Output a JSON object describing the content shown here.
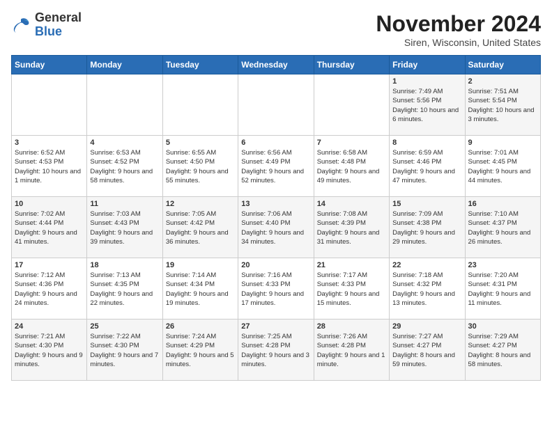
{
  "header": {
    "logo_general": "General",
    "logo_blue": "Blue",
    "month_title": "November 2024",
    "location": "Siren, Wisconsin, United States"
  },
  "weekdays": [
    "Sunday",
    "Monday",
    "Tuesday",
    "Wednesday",
    "Thursday",
    "Friday",
    "Saturday"
  ],
  "weeks": [
    [
      {
        "day": "",
        "info": ""
      },
      {
        "day": "",
        "info": ""
      },
      {
        "day": "",
        "info": ""
      },
      {
        "day": "",
        "info": ""
      },
      {
        "day": "",
        "info": ""
      },
      {
        "day": "1",
        "info": "Sunrise: 7:49 AM\nSunset: 5:56 PM\nDaylight: 10 hours and 6 minutes."
      },
      {
        "day": "2",
        "info": "Sunrise: 7:51 AM\nSunset: 5:54 PM\nDaylight: 10 hours and 3 minutes."
      }
    ],
    [
      {
        "day": "3",
        "info": "Sunrise: 6:52 AM\nSunset: 4:53 PM\nDaylight: 10 hours and 1 minute."
      },
      {
        "day": "4",
        "info": "Sunrise: 6:53 AM\nSunset: 4:52 PM\nDaylight: 9 hours and 58 minutes."
      },
      {
        "day": "5",
        "info": "Sunrise: 6:55 AM\nSunset: 4:50 PM\nDaylight: 9 hours and 55 minutes."
      },
      {
        "day": "6",
        "info": "Sunrise: 6:56 AM\nSunset: 4:49 PM\nDaylight: 9 hours and 52 minutes."
      },
      {
        "day": "7",
        "info": "Sunrise: 6:58 AM\nSunset: 4:48 PM\nDaylight: 9 hours and 49 minutes."
      },
      {
        "day": "8",
        "info": "Sunrise: 6:59 AM\nSunset: 4:46 PM\nDaylight: 9 hours and 47 minutes."
      },
      {
        "day": "9",
        "info": "Sunrise: 7:01 AM\nSunset: 4:45 PM\nDaylight: 9 hours and 44 minutes."
      }
    ],
    [
      {
        "day": "10",
        "info": "Sunrise: 7:02 AM\nSunset: 4:44 PM\nDaylight: 9 hours and 41 minutes."
      },
      {
        "day": "11",
        "info": "Sunrise: 7:03 AM\nSunset: 4:43 PM\nDaylight: 9 hours and 39 minutes."
      },
      {
        "day": "12",
        "info": "Sunrise: 7:05 AM\nSunset: 4:42 PM\nDaylight: 9 hours and 36 minutes."
      },
      {
        "day": "13",
        "info": "Sunrise: 7:06 AM\nSunset: 4:40 PM\nDaylight: 9 hours and 34 minutes."
      },
      {
        "day": "14",
        "info": "Sunrise: 7:08 AM\nSunset: 4:39 PM\nDaylight: 9 hours and 31 minutes."
      },
      {
        "day": "15",
        "info": "Sunrise: 7:09 AM\nSunset: 4:38 PM\nDaylight: 9 hours and 29 minutes."
      },
      {
        "day": "16",
        "info": "Sunrise: 7:10 AM\nSunset: 4:37 PM\nDaylight: 9 hours and 26 minutes."
      }
    ],
    [
      {
        "day": "17",
        "info": "Sunrise: 7:12 AM\nSunset: 4:36 PM\nDaylight: 9 hours and 24 minutes."
      },
      {
        "day": "18",
        "info": "Sunrise: 7:13 AM\nSunset: 4:35 PM\nDaylight: 9 hours and 22 minutes."
      },
      {
        "day": "19",
        "info": "Sunrise: 7:14 AM\nSunset: 4:34 PM\nDaylight: 9 hours and 19 minutes."
      },
      {
        "day": "20",
        "info": "Sunrise: 7:16 AM\nSunset: 4:33 PM\nDaylight: 9 hours and 17 minutes."
      },
      {
        "day": "21",
        "info": "Sunrise: 7:17 AM\nSunset: 4:33 PM\nDaylight: 9 hours and 15 minutes."
      },
      {
        "day": "22",
        "info": "Sunrise: 7:18 AM\nSunset: 4:32 PM\nDaylight: 9 hours and 13 minutes."
      },
      {
        "day": "23",
        "info": "Sunrise: 7:20 AM\nSunset: 4:31 PM\nDaylight: 9 hours and 11 minutes."
      }
    ],
    [
      {
        "day": "24",
        "info": "Sunrise: 7:21 AM\nSunset: 4:30 PM\nDaylight: 9 hours and 9 minutes."
      },
      {
        "day": "25",
        "info": "Sunrise: 7:22 AM\nSunset: 4:30 PM\nDaylight: 9 hours and 7 minutes."
      },
      {
        "day": "26",
        "info": "Sunrise: 7:24 AM\nSunset: 4:29 PM\nDaylight: 9 hours and 5 minutes."
      },
      {
        "day": "27",
        "info": "Sunrise: 7:25 AM\nSunset: 4:28 PM\nDaylight: 9 hours and 3 minutes."
      },
      {
        "day": "28",
        "info": "Sunrise: 7:26 AM\nSunset: 4:28 PM\nDaylight: 9 hours and 1 minute."
      },
      {
        "day": "29",
        "info": "Sunrise: 7:27 AM\nSunset: 4:27 PM\nDaylight: 8 hours and 59 minutes."
      },
      {
        "day": "30",
        "info": "Sunrise: 7:29 AM\nSunset: 4:27 PM\nDaylight: 8 hours and 58 minutes."
      }
    ]
  ]
}
